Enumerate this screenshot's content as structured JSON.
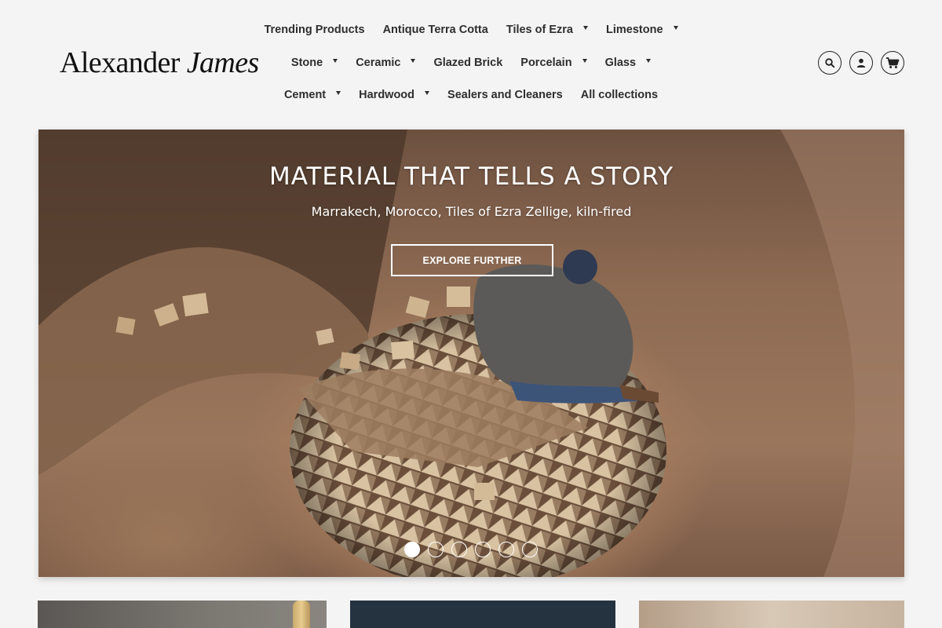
{
  "brand": {
    "name_part1": "Alexander",
    "name_part2": "James"
  },
  "nav": {
    "row1": [
      {
        "label": "Trending Products",
        "dropdown": false
      },
      {
        "label": "Antique Terra Cotta",
        "dropdown": false
      },
      {
        "label": "Tiles of Ezra",
        "dropdown": true
      },
      {
        "label": "Limestone",
        "dropdown": true
      }
    ],
    "row2": [
      {
        "label": "Stone",
        "dropdown": true
      },
      {
        "label": "Ceramic",
        "dropdown": true
      },
      {
        "label": "Glazed Brick",
        "dropdown": false
      },
      {
        "label": "Porcelain",
        "dropdown": true
      },
      {
        "label": "Glass",
        "dropdown": true
      }
    ],
    "row3": [
      {
        "label": "Cement",
        "dropdown": true
      },
      {
        "label": "Hardwood",
        "dropdown": true
      },
      {
        "label": "Sealers and Cleaners",
        "dropdown": false
      },
      {
        "label": "All collections",
        "dropdown": false
      }
    ]
  },
  "header_icons": [
    "search-icon",
    "account-icon",
    "cart-icon"
  ],
  "hero": {
    "title": "MATERIAL THAT TELLS A STORY",
    "subtitle": "Marrakech, Morocco, Tiles of Ezra Zellige, kiln-fired",
    "button_label": "EXPLORE FURTHER",
    "slide_count": 6,
    "active_slide": 1
  },
  "colors": {
    "background": "#f4f4f4",
    "text": "#2e2e2e",
    "hero_overlay_text": "#ffffff"
  }
}
